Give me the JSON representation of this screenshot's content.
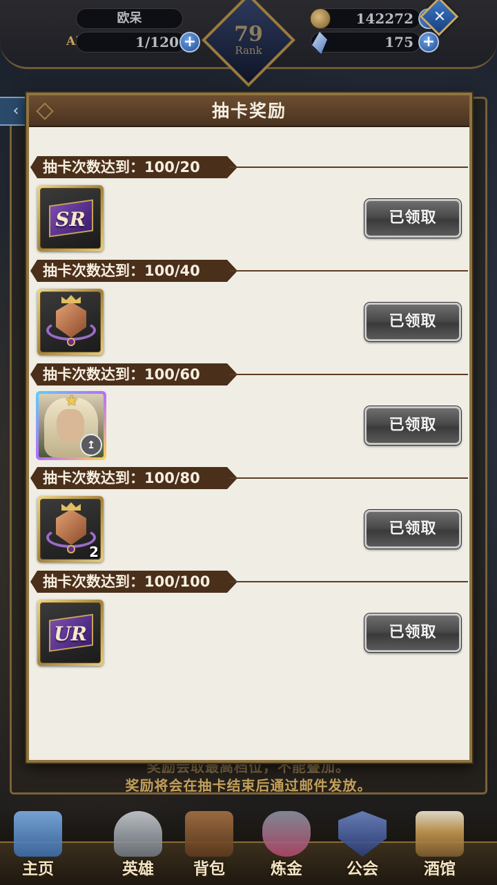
{
  "hud": {
    "player_name": "欧呆",
    "ap_label": "AP",
    "ap_value": "1/120",
    "rank_value": "79",
    "rank_label": "Rank",
    "gold_value": "142272",
    "gem_value": "175"
  },
  "background": {
    "notice_line1": "奖励会取最高档位，不能叠加。",
    "notice_line2": "奖励将会在抽卡结束后通过邮件发放。"
  },
  "modal": {
    "title": "抽卡奖励",
    "rows": [
      {
        "label": "抽卡次数达到：100/20",
        "item": "SR",
        "qty": "",
        "button": "已领取"
      },
      {
        "label": "抽卡次数达到：100/40",
        "item": "crest",
        "qty": "",
        "button": "已领取"
      },
      {
        "label": "抽卡次数达到：100/60",
        "item": "hero",
        "qty": "",
        "button": "已领取"
      },
      {
        "label": "抽卡次数达到：100/80",
        "item": "crest",
        "qty": "2",
        "button": "已领取"
      },
      {
        "label": "抽卡次数达到：100/100",
        "item": "UR",
        "qty": "",
        "button": "已领取"
      }
    ]
  },
  "nav": {
    "items": [
      {
        "label": "主页",
        "icon": "castle-icon",
        "color": "#4f86c9"
      },
      {
        "label": "英雄",
        "icon": "helmet-icon",
        "color": "#9aa3ad"
      },
      {
        "label": "背包",
        "icon": "backpack-icon",
        "color": "#8a5a33"
      },
      {
        "label": "炼金",
        "icon": "potion-icon",
        "color": "#b0476a"
      },
      {
        "label": "公会",
        "icon": "shield-icon",
        "color": "#4a63a8"
      },
      {
        "label": "酒馆",
        "icon": "beer-icon",
        "color": "#c89b52"
      }
    ]
  }
}
